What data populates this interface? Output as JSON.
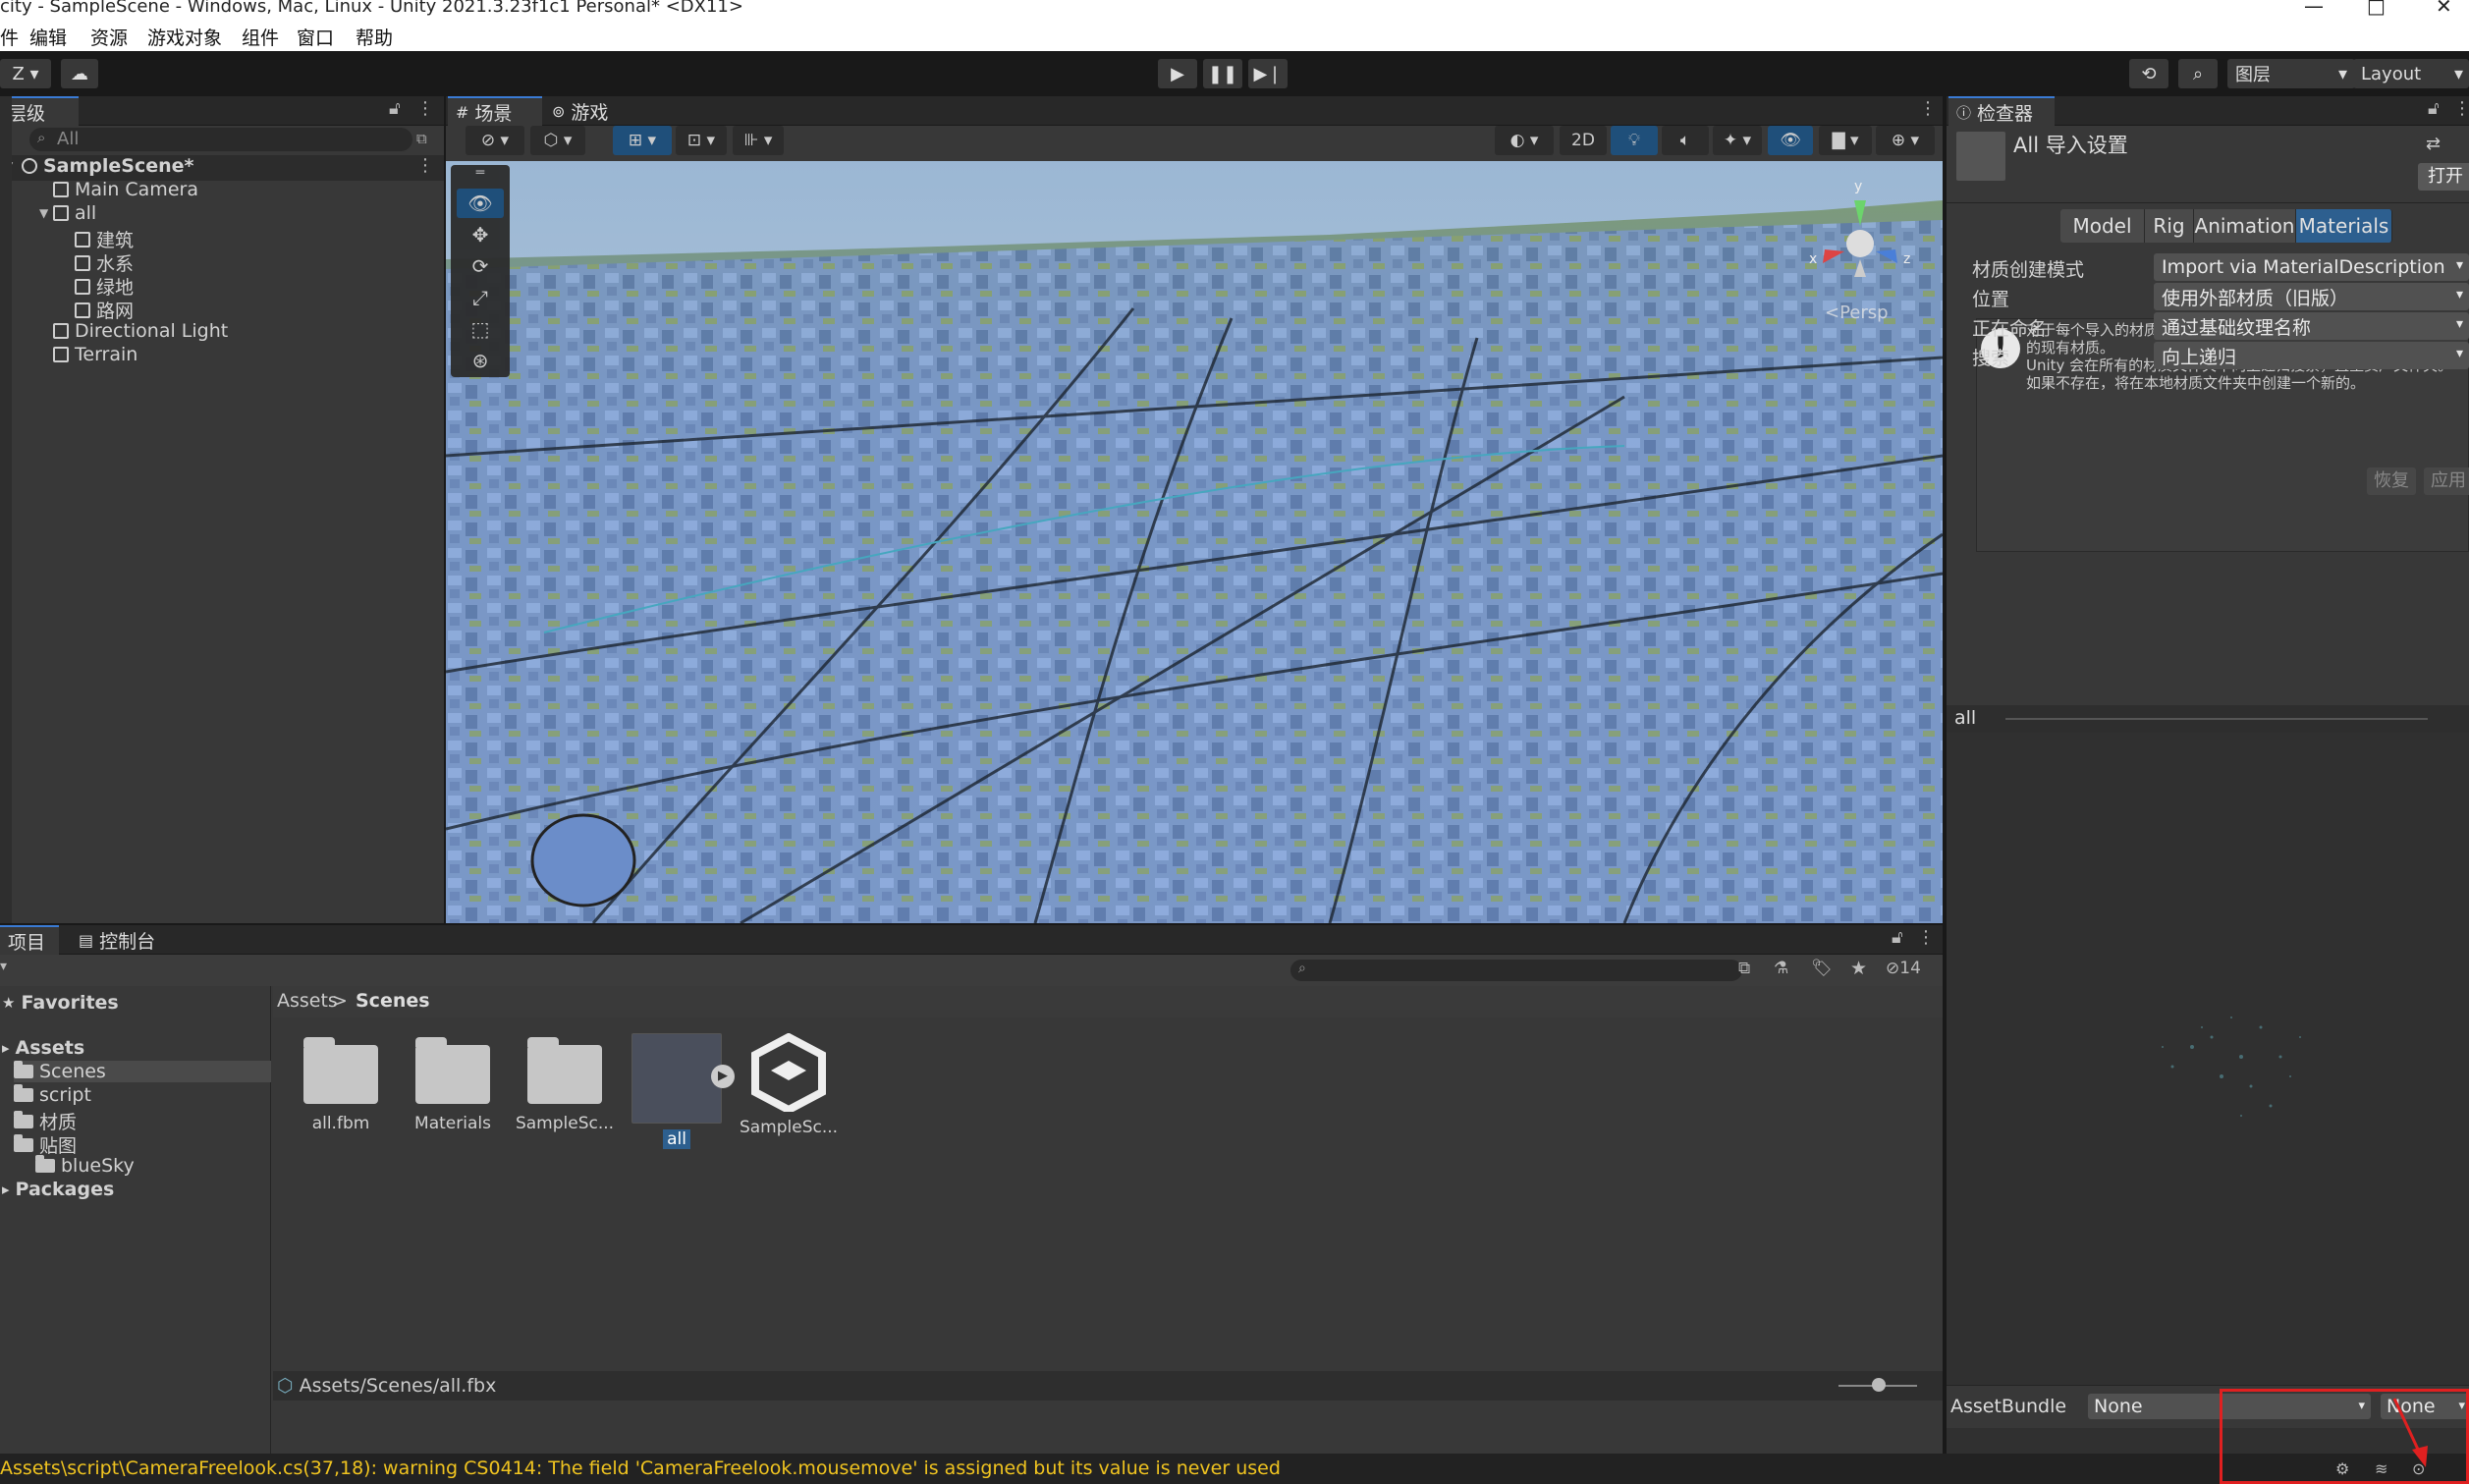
{
  "window": {
    "title": "city - SampleScene - Windows, Mac, Linux - Unity 2021.3.23f1c1 Personal* <DX11>",
    "controls": [
      "—",
      "□",
      "✕"
    ]
  },
  "menu": [
    "件",
    "编辑",
    "资源",
    "游戏对象",
    "组件",
    "窗口",
    "帮助"
  ],
  "toolbar": {
    "account_label": "Z",
    "layers_label": "图层",
    "layout_label": "Layout"
  },
  "hierarchy": {
    "tab_label": "层级",
    "search_placeholder": "All",
    "items": [
      {
        "label": "SampleScene*",
        "depth": 0
      },
      {
        "label": "Main Camera",
        "depth": 1
      },
      {
        "label": "all",
        "depth": 1
      },
      {
        "label": "建筑",
        "depth": 2
      },
      {
        "label": "水系",
        "depth": 2
      },
      {
        "label": "绿地",
        "depth": 2
      },
      {
        "label": "路网",
        "depth": 2
      },
      {
        "label": "Directional Light",
        "depth": 1
      },
      {
        "label": "Terrain",
        "depth": 1
      }
    ]
  },
  "scene": {
    "tabs": [
      "场景",
      "游戏"
    ],
    "btn_2d": "2D",
    "persp_label": "<Persp",
    "gizmo": {
      "x": "x",
      "y": "y",
      "z": "z"
    }
  },
  "inspector": {
    "tab_label": "检查器",
    "asset_title": "All 导入设置",
    "open_button": "打开",
    "tabs": [
      "Model",
      "Rig",
      "Animation",
      "Materials"
    ],
    "active_tab": "Materials",
    "props": [
      {
        "label": "材质创建模式",
        "value": "Import via MaterialDescription"
      },
      {
        "label": "位置",
        "value": "使用外部材质（旧版）"
      },
      {
        "label": "正在命名",
        "value": "通过基础纹理名称"
      },
      {
        "label": "搜索",
        "value": "向上递归"
      }
    ],
    "info_lines": [
      "对于每个导入的材质，Unity 将首先查找名为 [BaseTextureName]",
      "的现有材质。",
      "Unity 会在所有的材质文件夹中向上递归搜索，直至资产文件夹。",
      "如果不存在，将在本地材质文件夹中创建一个新的。"
    ],
    "revert_button": "恢复",
    "apply_button": "应用",
    "preview_label": "all",
    "assetbundle_label": "AssetBundle",
    "assetbundle_value": "None",
    "assetbundle_variant": "None"
  },
  "project": {
    "tabs": [
      "项目",
      "控制台"
    ],
    "hidden_count": "14",
    "tree": [
      {
        "label": "Favorites",
        "bold": true,
        "depth": 0
      },
      {
        "label": "Assets",
        "bold": true,
        "depth": 0
      },
      {
        "label": "Scenes",
        "bold": false,
        "depth": 1
      },
      {
        "label": "script",
        "bold": false,
        "depth": 1
      },
      {
        "label": "材质",
        "bold": false,
        "depth": 1
      },
      {
        "label": "贴图",
        "bold": false,
        "depth": 1
      },
      {
        "label": "blueSky",
        "bold": false,
        "depth": 2
      },
      {
        "label": "Packages",
        "bold": true,
        "depth": 0
      }
    ],
    "breadcrumb": [
      "Assets",
      "Scenes"
    ],
    "files": [
      {
        "label": "all.fbm",
        "kind": "folder"
      },
      {
        "label": "Materials",
        "kind": "folder"
      },
      {
        "label": "SampleSc...",
        "kind": "folder"
      },
      {
        "label": "all",
        "kind": "model"
      },
      {
        "label": "SampleSc...",
        "kind": "unity"
      }
    ],
    "path": "Assets/Scenes/all.fbx"
  },
  "status": {
    "message": "Assets\\script\\CameraFreelook.cs(37,18): warning CS0414: The field 'CameraFreelook.mousemove' is assigned but its value is never used"
  },
  "colors": {
    "accent": "#3a7bd5",
    "warning": "#f0c420",
    "highlight": "#e02020"
  }
}
